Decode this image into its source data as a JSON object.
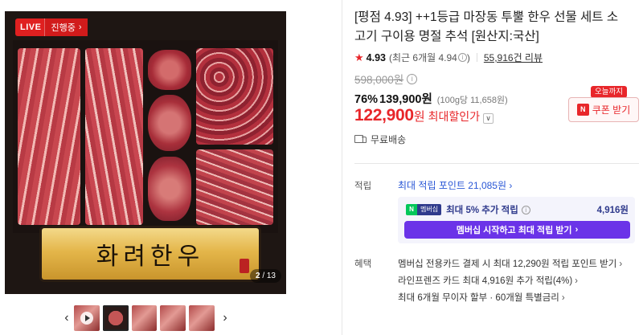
{
  "gallery": {
    "live_label": "LIVE",
    "live_status": "진행중",
    "brand_text": "화려한우",
    "page_current": "2",
    "page_total": "13",
    "thumb_count": 5,
    "active_thumb": 2
  },
  "product": {
    "title": "[평점 4.93] ++1등급 마장동 투뿔 한우 선물 세트 소고기 구이용 명절 추석 [원산지:국산]",
    "rating_score": "4.93",
    "rating_recent": "(최근 6개월 4.94",
    "rating_recent_close": ")",
    "review_count": "55,916건 리뷰",
    "original_price": "598,000원",
    "discount_rate": "76%",
    "sale_price": "139,900원",
    "unit_price": "(100g당 11,658원)",
    "max_discount_price": "122,900",
    "max_discount_won": "원",
    "max_discount_label": "최대할인가",
    "shipping": "무료배송"
  },
  "coupon": {
    "tooltip": "오늘까지",
    "label": "쿠폰 받기",
    "icon_letter": "N"
  },
  "points": {
    "label": "적립",
    "max_points": "최대 적립 포인트 21,085원",
    "membership_badge_n": "N",
    "membership_badge_text": "멤버십",
    "membership_extra": "최대 5% 추가 적립",
    "membership_amount": "4,916원",
    "membership_button": "멤버십 시작하고 최대 적립 받기"
  },
  "benefits": {
    "label": "혜택",
    "items": [
      "멤버십 전용카드 결제 시 최대 12,290원 적립 포인트 받기",
      "라인프렌즈 카드 최대 4,916원 추가 적립(4%)",
      "최대 6개월 무이자 할부 · 60개월 특별금리"
    ]
  },
  "colors": {
    "accent_red": "#e8262a",
    "link_blue": "#2a57d6",
    "membership_purple": "#6b33e8",
    "naver_green": "#03c75a"
  }
}
